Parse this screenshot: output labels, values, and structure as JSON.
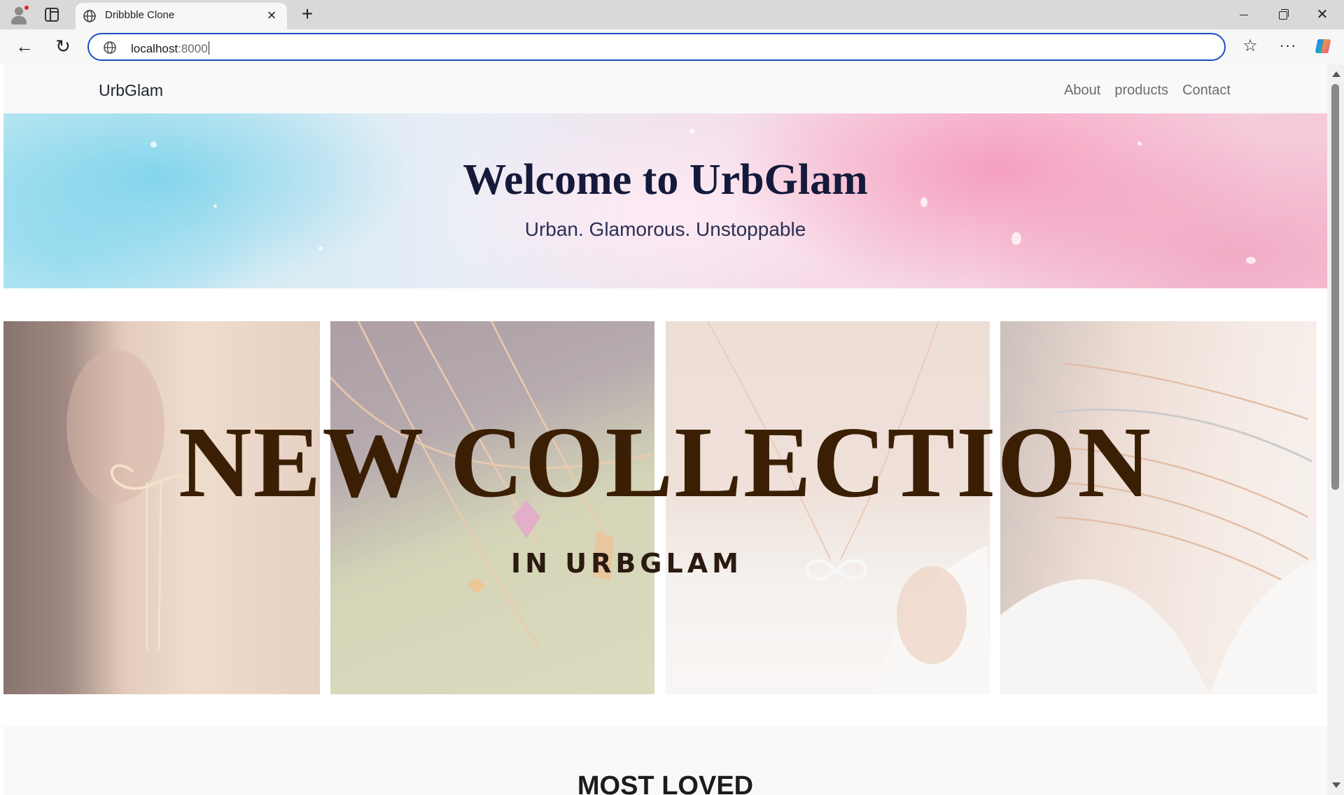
{
  "browser": {
    "tab_title": "Dribbble Clone",
    "tab_close": "×",
    "new_tab": "+",
    "url_host": "localhost",
    "url_port": ":8000",
    "window_close": "✕",
    "nav_back": "←",
    "nav_reload": "↻",
    "favorites": "☆",
    "more": "···"
  },
  "site": {
    "brand": "UrbGlam",
    "nav": [
      "About",
      "products",
      "Contact"
    ],
    "hero_title": "Welcome to UrbGlam",
    "hero_subtitle": "Urban. Glamorous. Unstoppable",
    "collection_title": "NEW COLLECTION",
    "collection_subtitle": "IN URBGLAM",
    "section_title": "MOST LOVED"
  },
  "colors": {
    "address_focus": "#1a4fbf",
    "collection_text": "#3b1f05",
    "hero_title": "#151a3a"
  }
}
